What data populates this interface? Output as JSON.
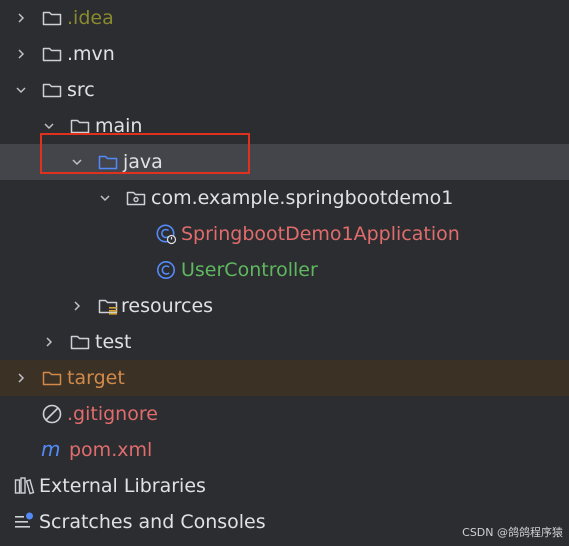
{
  "tree": {
    "idea": {
      "label": ".idea",
      "icon": "folder-icon"
    },
    "mvn": {
      "label": ".mvn",
      "icon": "folder-icon"
    },
    "src": {
      "label": "src",
      "icon": "folder-icon"
    },
    "main": {
      "label": "main",
      "icon": "folder-icon"
    },
    "java": {
      "label": "java",
      "icon": "source-folder-icon"
    },
    "package": {
      "label": "com.example.springbootdemo1",
      "icon": "package-icon"
    },
    "app_class": {
      "label": "SpringbootDemo1Application",
      "icon": "spring-boot-class-icon"
    },
    "controller_class": {
      "label": "UserController",
      "icon": "class-icon"
    },
    "resources": {
      "label": "resources",
      "icon": "resources-folder-icon"
    },
    "test": {
      "label": "test",
      "icon": "folder-icon"
    },
    "target": {
      "label": "target",
      "icon": "excluded-folder-icon"
    },
    "gitignore": {
      "label": ".gitignore",
      "icon": "ignore-icon"
    },
    "pom": {
      "label": "pom.xml",
      "icon": "maven-icon"
    },
    "external_libraries": {
      "label": "External Libraries",
      "icon": "library-icon"
    },
    "scratches": {
      "label": "Scratches and Consoles",
      "icon": "scratches-icon"
    }
  },
  "watermark": "CSDN @鸽鸽程序猿",
  "colors": {
    "background": "#2b2d30",
    "selected_row": "#43454a",
    "excluded_row": "#3c3125",
    "highlight_box": "#e0301e",
    "source_folder": "#548af7",
    "class_icon": "#548af7"
  }
}
